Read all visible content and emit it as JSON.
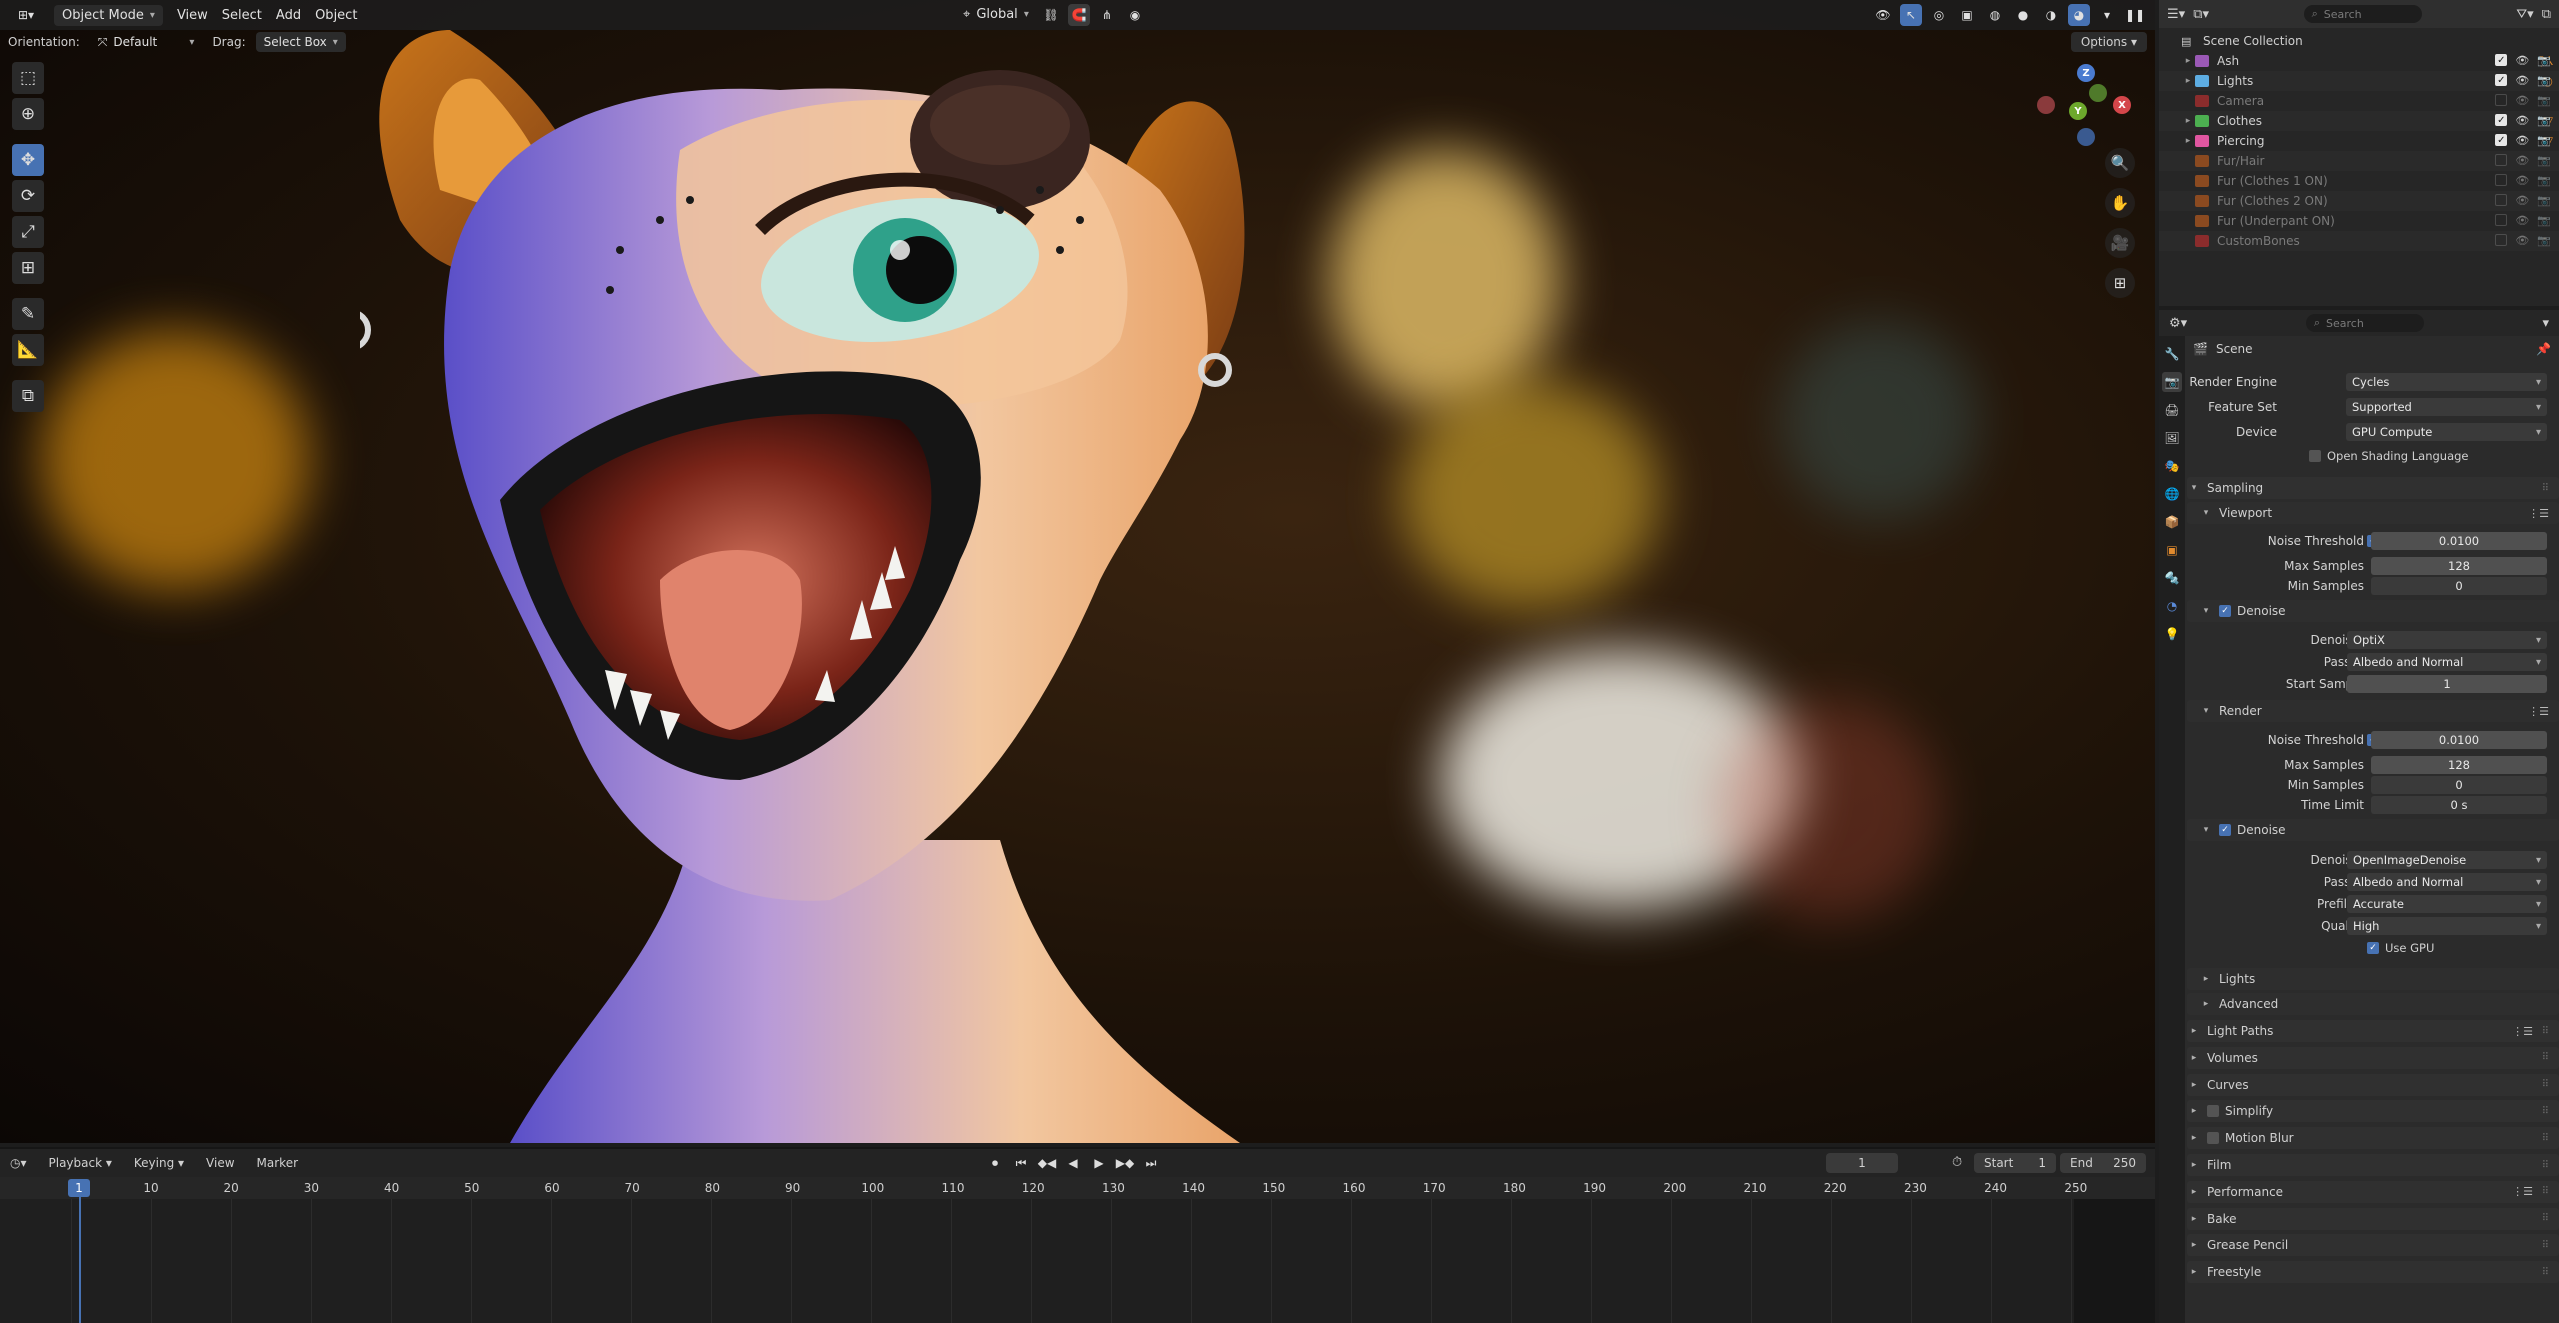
{
  "viewport": {
    "mode": "Object Mode",
    "menus": [
      "View",
      "Select",
      "Add",
      "Object"
    ],
    "transform_orientation": "Global",
    "orientation_label": "Orientation:",
    "orientation_value": "Default",
    "drag_label": "Drag:",
    "drag_value": "Select Box",
    "options_label": "Options",
    "gizmo_axes": [
      "X",
      "Y",
      "Z"
    ]
  },
  "timeline": {
    "menus": [
      "Playback",
      "Keying",
      "View",
      "Marker"
    ],
    "current_frame": "1",
    "start_label": "Start",
    "start_value": "1",
    "end_label": "End",
    "end_value": "250",
    "ruler_ticks": [
      "10",
      "20",
      "30",
      "40",
      "50",
      "60",
      "70",
      "80",
      "90",
      "100",
      "110",
      "120",
      "130",
      "140",
      "150",
      "160",
      "170",
      "180",
      "190",
      "200",
      "210",
      "220",
      "230",
      "240",
      "250"
    ]
  },
  "outliner": {
    "search_placeholder": "Search",
    "root": "Scene Collection",
    "items": [
      {
        "label": "Ash",
        "color": "#9b59b6",
        "dim": false,
        "extra": "⚲⅄"
      },
      {
        "label": "Lights",
        "color": "#5dade2",
        "dim": false,
        "extra": "◐"
      },
      {
        "label": "Camera",
        "color": "#8b2c2c",
        "dim": true,
        "extra": ""
      },
      {
        "label": "Clothes",
        "color": "#4caf50",
        "dim": false,
        "extra": "▽"
      },
      {
        "label": "Piercing",
        "color": "#e056a0",
        "dim": false,
        "extra": "▽"
      },
      {
        "label": "Fur/Hair",
        "color": "#8b4a20",
        "dim": true,
        "extra": ""
      },
      {
        "label": "Fur (Clothes 1 ON)",
        "color": "#8b4a20",
        "dim": true,
        "extra": ""
      },
      {
        "label": "Fur (Clothes 2 ON)",
        "color": "#8b4a20",
        "dim": true,
        "extra": ""
      },
      {
        "label": "Fur (Underpant ON)",
        "color": "#8b4a20",
        "dim": true,
        "extra": ""
      },
      {
        "label": "CustomBones",
        "color": "#8b2c2c",
        "dim": true,
        "extra": ""
      }
    ]
  },
  "properties": {
    "search_placeholder": "Search",
    "scene": "Scene",
    "render_engine_label": "Render Engine",
    "render_engine": "Cycles",
    "feature_set_label": "Feature Set",
    "feature_set": "Supported",
    "device_label": "Device",
    "device": "GPU Compute",
    "osl_label": "Open Shading Language",
    "sampling": "Sampling",
    "viewport": "Viewport",
    "vp_noise_label": "Noise Threshold",
    "vp_noise": "0.0100",
    "vp_max_label": "Max Samples",
    "vp_max": "128",
    "vp_min_label": "Min Samples",
    "vp_min": "0",
    "vp_denoise": "Denoise",
    "vp_denoiser_label": "Denoiser",
    "vp_denoiser": "OptiX",
    "vp_passes_label": "Passes",
    "vp_passes": "Albedo and Normal",
    "vp_start_label": "Start Sample",
    "vp_start": "1",
    "render": "Render",
    "r_noise_label": "Noise Threshold",
    "r_noise": "0.0100",
    "r_max_label": "Max Samples",
    "r_max": "128",
    "r_min_label": "Min Samples",
    "r_min": "0",
    "r_time_label": "Time Limit",
    "r_time": "0 s",
    "r_denoise": "Denoise",
    "r_denoiser_label": "Denoiser",
    "r_denoiser": "OpenImageDenoise",
    "r_passes_label": "Passes",
    "r_passes": "Albedo and Normal",
    "r_prefilter_label": "Prefilter",
    "r_prefilter": "Accurate",
    "r_quality_label": "Quality",
    "r_quality": "High",
    "r_usegpu": "Use GPU",
    "sub_panels": [
      "Lights",
      "Advanced"
    ],
    "panels": [
      "Light Paths",
      "Volumes",
      "Curves",
      "Simplify",
      "Motion Blur",
      "Film",
      "Performance",
      "Bake",
      "Grease Pencil",
      "Freestyle"
    ]
  }
}
